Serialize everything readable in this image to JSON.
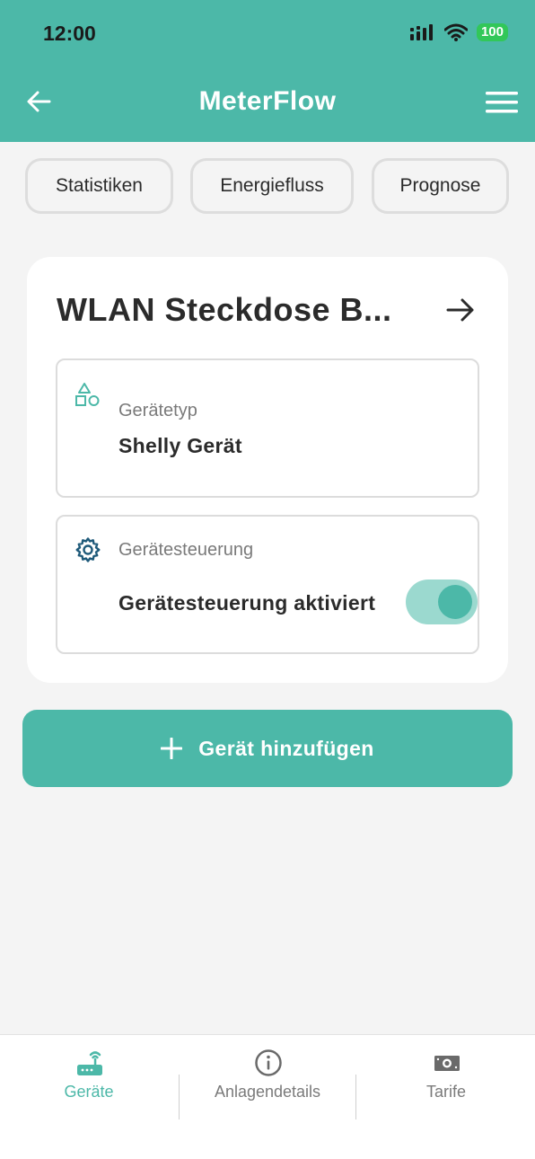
{
  "status_bar": {
    "time": "12:00",
    "battery": "100"
  },
  "header": {
    "title": "MeterFlow",
    "back_icon": "arrow-left-icon",
    "menu_icon": "hamburger-menu-icon"
  },
  "tabs": [
    {
      "label": "Statistiken"
    },
    {
      "label": "Energiefluss"
    },
    {
      "label": "Prognose"
    }
  ],
  "device_card": {
    "title": "WLAN Steckdose B...",
    "device_type": {
      "label": "Gerätetyp",
      "value": "Shelly Gerät",
      "icon": "shapes-icon"
    },
    "device_control": {
      "label": "Gerätesteuerung",
      "toggle_label": "Gerätesteuerung aktiviert",
      "toggle_on": true,
      "icon": "gear-icon"
    }
  },
  "add_button": {
    "label": "Gerät hinzufügen"
  },
  "bottom_nav": [
    {
      "label": "Geräte",
      "icon": "router-icon",
      "active": true
    },
    {
      "label": "Anlagendetails",
      "icon": "info-icon",
      "active": false
    },
    {
      "label": "Tarife",
      "icon": "banknote-icon",
      "active": false
    }
  ],
  "colors": {
    "primary": "#4cb8a8",
    "toggle_track": "#9bd9cf",
    "background": "#f4f4f4",
    "gear": "#1f5a7a"
  }
}
